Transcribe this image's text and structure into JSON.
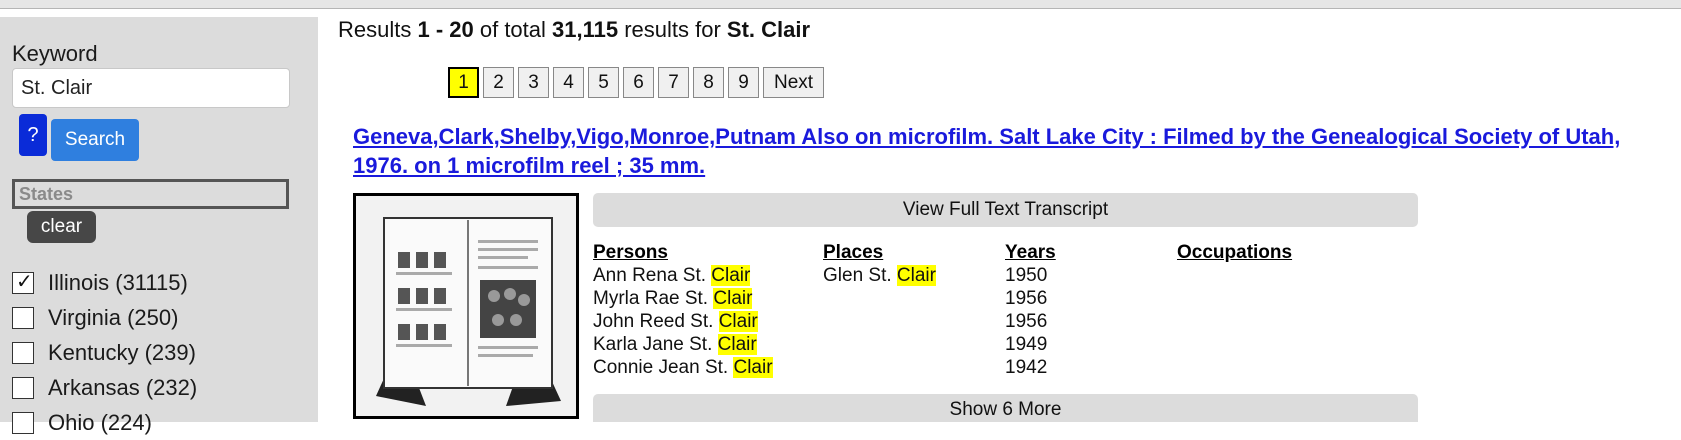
{
  "sidebar": {
    "keyword_label": "Keyword",
    "keyword_value": "St. Clair",
    "help_label": "?",
    "search_label": "Search",
    "states_placeholder": "States",
    "clear_label": "clear",
    "states": [
      {
        "label": "Illinois (31115)",
        "checked": true
      },
      {
        "label": "Virginia (250)",
        "checked": false
      },
      {
        "label": "Kentucky (239)",
        "checked": false
      },
      {
        "label": "Arkansas (232)",
        "checked": false
      },
      {
        "label": "Ohio (224)",
        "checked": false
      }
    ]
  },
  "results": {
    "prefix": "Results ",
    "range": "1 - 20",
    "mid": " of total ",
    "total": "31,115",
    "suffix": " results for ",
    "query": "St. Clair"
  },
  "pagination": {
    "pages": [
      "1",
      "2",
      "3",
      "4",
      "5",
      "6",
      "7",
      "8",
      "9"
    ],
    "current": "1",
    "next_label": "Next"
  },
  "record": {
    "title": "Geneva,Clark,Shelby,Vigo,Monroe,Putnam Also on microfilm. Salt Lake City : Filmed by the Genealogical Society of Utah, 1976. on 1 microfilm reel ; 35 mm.",
    "view_transcript_label": "View Full Text Transcript",
    "show_more_label": "Show 6 More",
    "columns": {
      "persons": "Persons",
      "places": "Places",
      "years": "Years",
      "occupations": "Occupations"
    },
    "persons": [
      {
        "prefix": "Ann Rena St. ",
        "highlight": "Clair"
      },
      {
        "prefix": "Myrla Rae St. ",
        "highlight": "Clair"
      },
      {
        "prefix": "John Reed St. ",
        "highlight": "Clair"
      },
      {
        "prefix": "Karla Jane St. ",
        "highlight": "Clair"
      },
      {
        "prefix": "Connie Jean St. ",
        "highlight": "Clair"
      }
    ],
    "places": [
      {
        "prefix": "Glen St. ",
        "highlight": "Clair"
      }
    ],
    "years": [
      "1950",
      "1956",
      "1956",
      "1949",
      "1942"
    ]
  },
  "colors": {
    "highlight": "#ffff00",
    "link": "#1a1adc",
    "search_button": "#2f7fdf",
    "help_button": "#0a2bd8"
  }
}
